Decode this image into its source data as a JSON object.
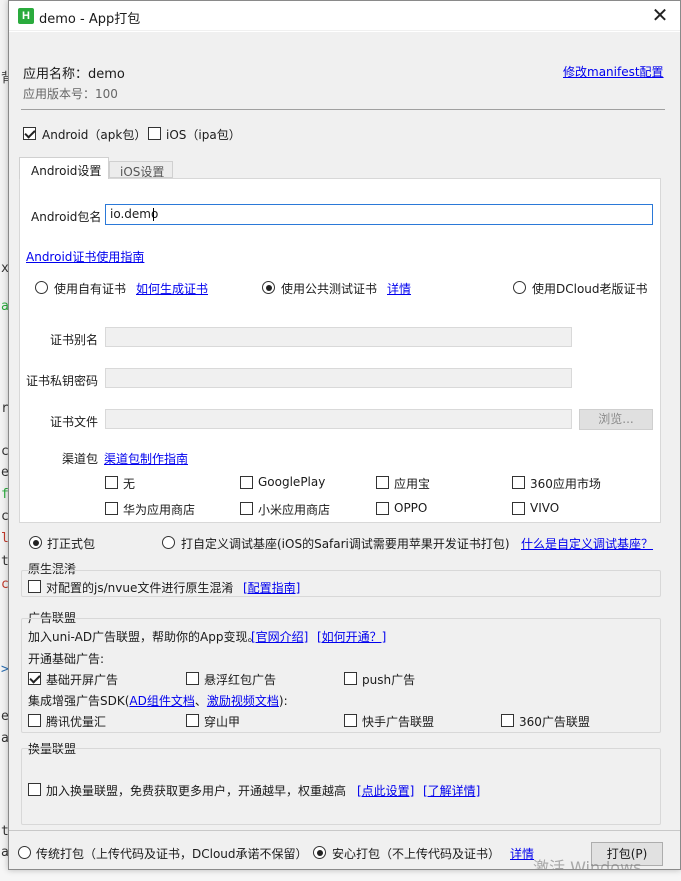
{
  "window": {
    "title": "demo - App打包",
    "app_icon": "H"
  },
  "header": {
    "app_name": "应用名称：demo",
    "app_version": "应用版本号：100",
    "manifest_link": "修改manifest配置"
  },
  "platforms": {
    "android": "Android（apk包）",
    "ios": "iOS（ipa包）",
    "android_checked": true,
    "ios_checked": false
  },
  "tabs": {
    "android": "Android设置",
    "ios": "iOS设置"
  },
  "android": {
    "package_label": "Android包名",
    "package_value": "io.demo",
    "cert_guide_link": "Android证书使用指南",
    "cert_own": "使用自有证书",
    "cert_how_link": "如何生成证书",
    "cert_public": "使用公共测试证书",
    "cert_detail_link": "详情",
    "cert_dcloud": "使用DCloud老版证书",
    "alias_label": "证书别名",
    "keypass_label": "证书私钥密码",
    "file_label": "证书文件",
    "browse_button": "浏览...",
    "channel_label": "渠道包",
    "channel_guide_link": "渠道包制作指南",
    "channels": [
      "无",
      "GooglePlay",
      "应用宝",
      "360应用市场",
      "华为应用商店",
      "小米应用商店",
      "OPPO",
      "VIVO"
    ]
  },
  "build_type": {
    "formal": "打正式包",
    "custom": "打自定义调试基座(iOS的Safari调试需要用苹果开发证书打包)",
    "custom_link": "什么是自定义调试基座？"
  },
  "obfuscation": {
    "title": "原生混淆",
    "checkbox": "对配置的js/nvue文件进行原生混淆",
    "guide_link": "[配置指南]"
  },
  "ads": {
    "title": "广告联盟",
    "intro": "加入uni-AD广告联盟，帮助你的App变现。",
    "intro_link1": "[官网介绍]",
    "intro_link2": "[如何开通？]",
    "basic_label": "开通基础广告:",
    "basic_items": [
      "基础开屏广告",
      "悬浮红包广告",
      "push广告"
    ],
    "enhanced_prefix": "集成增强广告SDK(",
    "enhanced_link1": "AD组件文档",
    "enhanced_sep": "、",
    "enhanced_link2": "激励视频文档",
    "enhanced_suffix": "):",
    "enhanced_items": [
      "腾讯优量汇",
      "穿山甲",
      "快手广告联盟",
      "360广告联盟"
    ]
  },
  "exchange": {
    "title": "换量联盟",
    "checkbox": "加入换量联盟，免费获取更多用户，开通越早，权重越高",
    "link1": "[点此设置]",
    "link2": "[了解详情]"
  },
  "footer": {
    "traditional": "传统打包（上传代码及证书，DCloud承诺不保留）",
    "secure": "安心打包（不上传代码及证书）",
    "detail_link": "详情",
    "pack_button": "打包(P)",
    "watermark": "激活 Windows"
  },
  "ide": {
    "chars": [
      "背",
      "x.",
      "a",
      "r",
      "c",
      "e",
      "f",
      "c",
      "l",
      "t",
      "c",
      ">",
      "e",
      "a",
      "t",
      "a"
    ]
  }
}
